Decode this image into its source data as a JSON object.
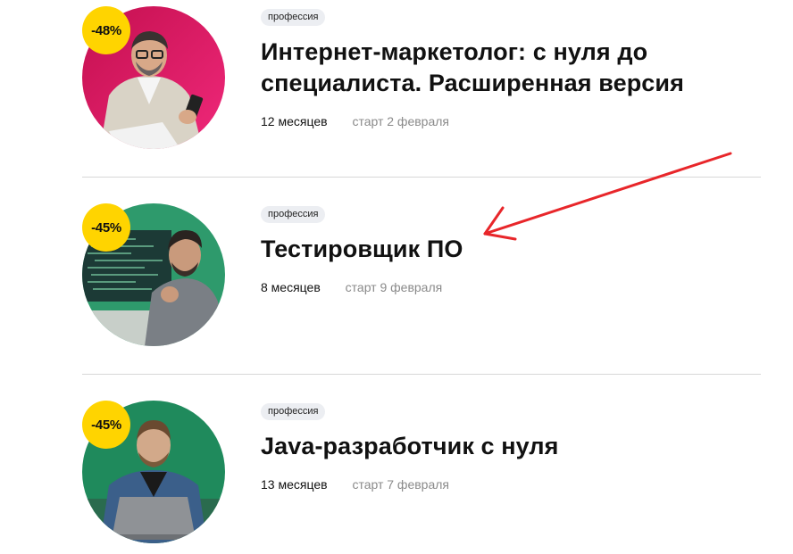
{
  "courses": [
    {
      "discount": "-48%",
      "tag": "профессия",
      "title": "Интернет-маркетолог: с нуля до специалиста. Расширенная версия",
      "duration": "12 месяцев",
      "start": "старт 2 февраля",
      "image_bg_color": "#d8185f"
    },
    {
      "discount": "-45%",
      "tag": "профессия",
      "title": "Тестировщик ПО",
      "duration": "8 месяцев",
      "start": "старт 9 февраля",
      "image_bg_color": "#2e9a6c"
    },
    {
      "discount": "-45%",
      "tag": "профессия",
      "title": "Java-разработчик с нуля",
      "duration": "13 месяцев",
      "start": "старт 7 февраля",
      "image_bg_color": "#1f8a5c"
    }
  ],
  "colors": {
    "discount_badge": "#ffd400",
    "tag_bg": "#eceef2",
    "divider": "#d7d7d7",
    "annotation_arrow": "#e8262a",
    "muted_text": "#8a8a8a"
  },
  "annotation": {
    "type": "arrow",
    "color": "#e8262a",
    "points_to": "Тестировщик ПО"
  }
}
